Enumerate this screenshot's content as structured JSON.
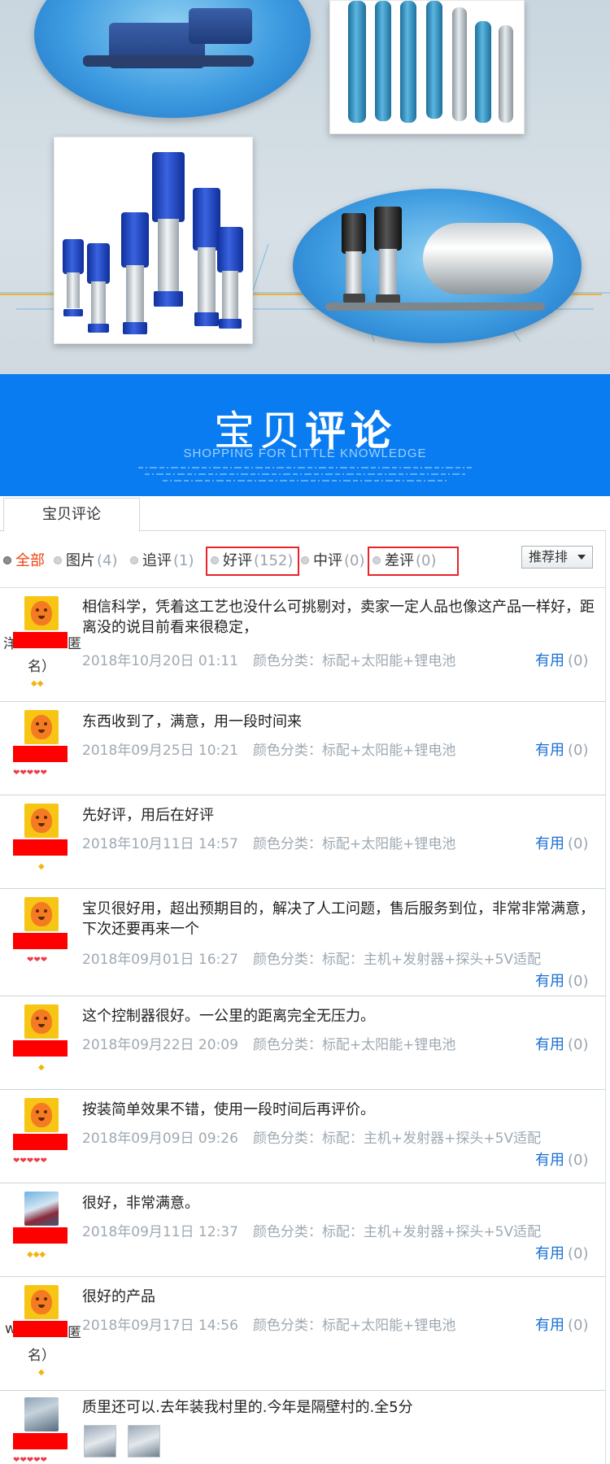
{
  "banner": {
    "title_light": "宝贝",
    "title_bold": "评论",
    "subtitle": "SHOPPING FOR LITTLE KNOWLEDGE"
  },
  "tabs": {
    "active": "宝贝评论"
  },
  "filters": [
    {
      "label": "全部",
      "count": "",
      "active": true
    },
    {
      "label": "图片",
      "count": "(4)"
    },
    {
      "label": "追评",
      "count": "(1)"
    },
    {
      "label": "好评",
      "count": "(152)"
    },
    {
      "label": "中评",
      "count": "(0)"
    },
    {
      "label": "差评",
      "count": "(0)"
    }
  ],
  "sort": {
    "label": "推荐排"
  },
  "useful_label": "有用",
  "reviews": [
    {
      "nick_left": "洋",
      "nick_right": "匿",
      "nick_bottom": "名）",
      "text": "相信科学，凭着这工艺也没什么可挑剔对，卖家一定人品也像这产品一样好，距离没的说目前看来很稳定，",
      "date": "2018年10月20日 01:11",
      "sku": "颜色分类：标配+太阳能+锂电池",
      "useful": "(0)",
      "stars": "◆◆"
    },
    {
      "text": "东西收到了，满意，用一段时间来",
      "date": "2018年09月25日 10:21",
      "sku": "颜色分类：标配+太阳能+锂电池",
      "useful": "(0)",
      "stars": "❤❤❤❤❤"
    },
    {
      "text": "先好评，用后在好评",
      "date": "2018年10月11日 14:57",
      "sku": "颜色分类：标配+太阳能+锂电池",
      "useful": "(0)",
      "stars": "◆"
    },
    {
      "text": "宝贝很好用，超出预期目的，解决了人工问题，售后服务到位，非常非常满意，下次还要再来一个",
      "date": "2018年09月01日 16:27",
      "sku": "颜色分类：标配：主机+发射器+探头+5V适配",
      "useful": "(0)",
      "stars": "❤❤❤"
    },
    {
      "text": "这个控制器很好。一公里的距离完全无压力。",
      "date": "2018年09月22日 20:09",
      "sku": "颜色分类：标配+太阳能+锂电池",
      "useful": "(0)",
      "stars": "◆"
    },
    {
      "text": "按装简单效果不错，使用一段时间后再评价。",
      "date": "2018年09月09日 09:26",
      "sku": "颜色分类：标配：主机+发射器+探头+5V适配",
      "useful": "(0)",
      "stars": "❤❤❤❤❤"
    },
    {
      "text": "很好，非常满意。",
      "date": "2018年09月11日 12:37",
      "sku": "颜色分类：标配：主机+发射器+探头+5V适配",
      "useful": "(0)",
      "stars": "◆◆◆"
    },
    {
      "nick_left": "w",
      "nick_right": "匿",
      "nick_bottom": "名）",
      "text": "很好的产品",
      "date": "2018年09月17日 14:56",
      "sku": "颜色分类：标配+太阳能+锂电池",
      "useful": "(0)",
      "stars": "◆"
    },
    {
      "text": "质里还可以.去年装我村里的.今年是隔壁村的.全5分",
      "stars": "❤❤❤❤❤"
    }
  ],
  "colors": {
    "banner_blue": "#0a7cf2",
    "link_blue": "#1a6fd3",
    "active_orange": "#f2420d",
    "highlight_red": "#e8232a",
    "redaction": "#ff0000"
  }
}
